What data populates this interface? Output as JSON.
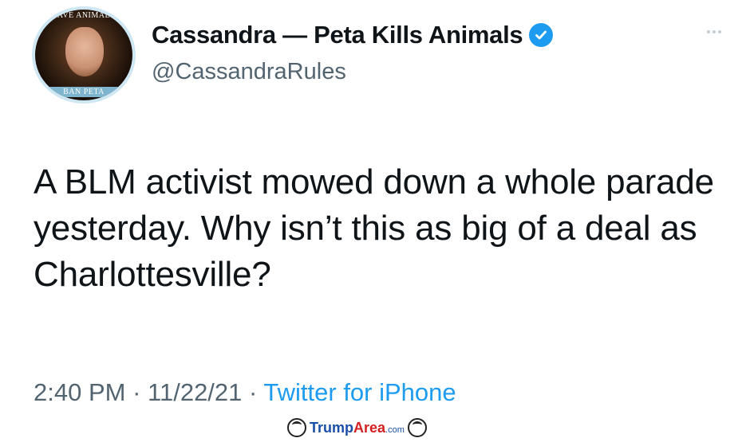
{
  "author": {
    "display_name": "Cassandra — Peta Kills Animals",
    "handle": "@CassandraRules",
    "verified_icon": "verified-badge-icon",
    "avatar": {
      "ring_top_text": "SAVE ANIMALS",
      "ring_bottom_text": "BAN PETA"
    }
  },
  "tweet": {
    "text": "A BLM activist mowed down a whole parade yesterday. Why isn’t this as big of a deal as Charlottesville?",
    "time": "2:40 PM",
    "separator": "·",
    "date": "11/22/21",
    "source": "Twitter for iPhone"
  },
  "more_icon": "more-options-icon",
  "watermark": {
    "brand_part1": "Trump",
    "brand_part2": "Area",
    "suffix": ".com"
  },
  "colors": {
    "text_primary": "#0f1419",
    "text_secondary": "#536471",
    "link_blue": "#1d9bf0"
  }
}
